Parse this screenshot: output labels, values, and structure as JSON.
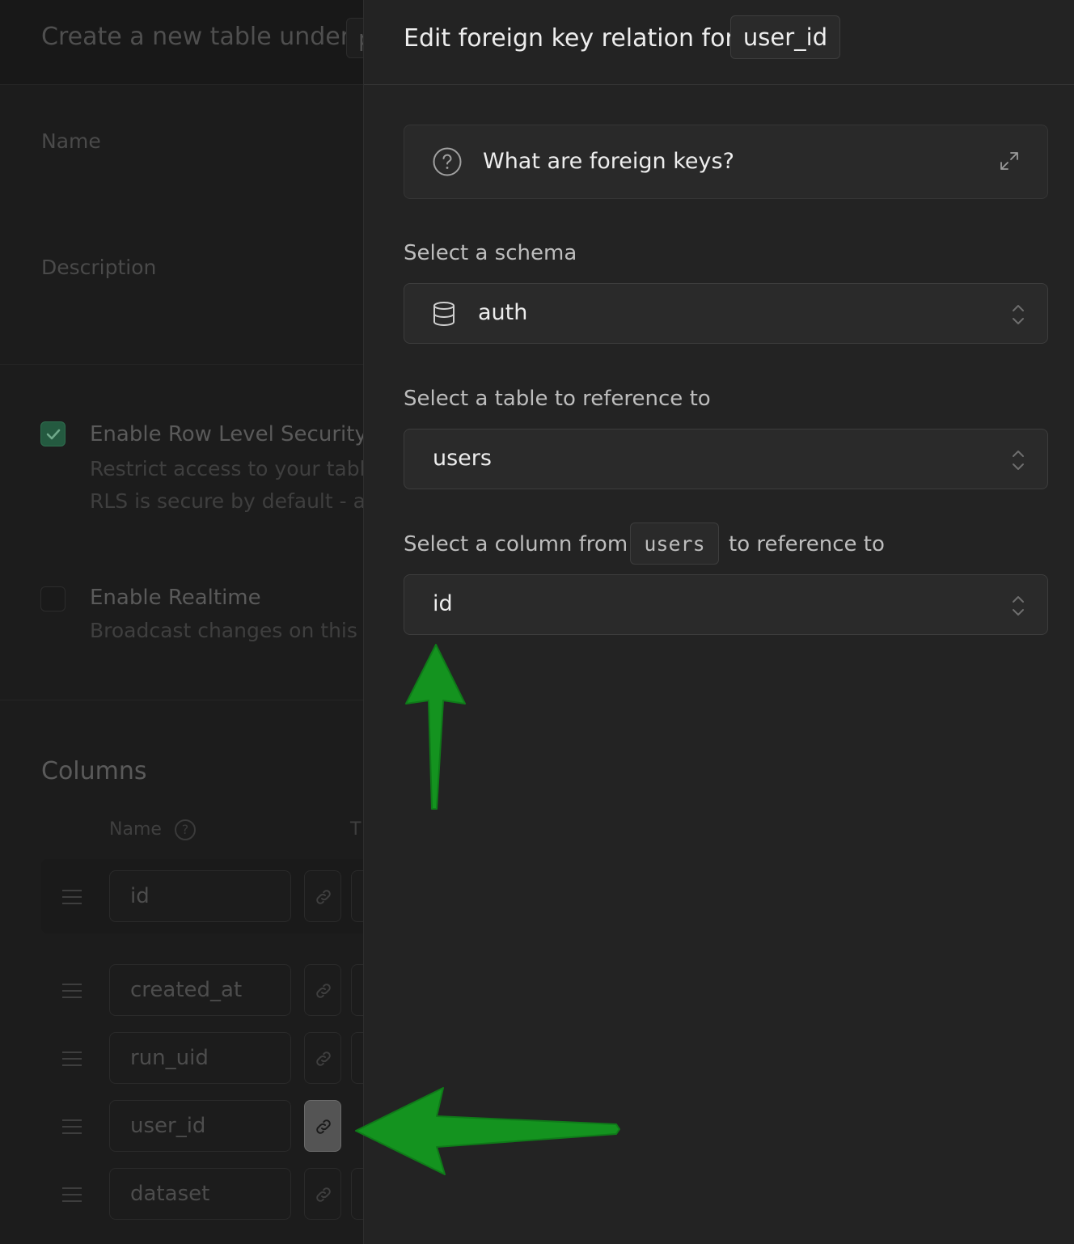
{
  "background_panel": {
    "title": "Create a new table under",
    "title_chip": "p",
    "name_label": "Name",
    "description_label": "Description",
    "rls": {
      "checked": true,
      "title": "Enable Row Level Security",
      "desc_line1": "Restrict access to your tabl",
      "desc_line2": "RLS is secure by default - a"
    },
    "realtime": {
      "checked": false,
      "title": "Enable Realtime",
      "desc": "Broadcast changes on this"
    },
    "columns_title": "Columns",
    "columns_header_name": "Name",
    "columns_header_type": "T",
    "columns": [
      {
        "name": "id"
      },
      {
        "name": "created_at"
      },
      {
        "name": "run_uid"
      },
      {
        "name": "user_id",
        "link_active": true
      },
      {
        "name": "dataset"
      }
    ]
  },
  "side_panel": {
    "title": "Edit foreign key relation for",
    "column_chip": "user_id",
    "info_card": {
      "text": "What are foreign keys?",
      "icon": "question-circle-icon",
      "expand_icon": "expand-icon"
    },
    "schema": {
      "label": "Select a schema",
      "value": "auth",
      "icon": "database-icon"
    },
    "table": {
      "label": "Select a table to reference to",
      "value": "users"
    },
    "column": {
      "label_prefix": "Select a column from",
      "label_chip": "users",
      "label_suffix": "to reference to",
      "value": "id"
    }
  },
  "colors": {
    "page_bg": "#151515",
    "panel_bg": "#232323",
    "annotation_arrow": "#14931f"
  }
}
